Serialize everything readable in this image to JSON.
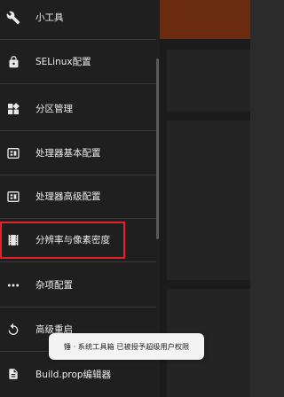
{
  "drawer": {
    "items": [
      {
        "label": "小工具",
        "icon": "wrench-icon"
      },
      {
        "label": "SELinux配置",
        "icon": "lock-icon"
      },
      {
        "label": "分区管理",
        "icon": "widgets-icon"
      },
      {
        "label": "处理器基本配置",
        "icon": "cpu-icon"
      },
      {
        "label": "处理器高级配置",
        "icon": "cpu-icon"
      },
      {
        "label": "分辨率与像素密度",
        "icon": "film-icon"
      },
      {
        "label": "杂项配置",
        "icon": "more-dots-icon"
      },
      {
        "label": "高级重启",
        "icon": "restart-icon"
      },
      {
        "label": "Build.prop编辑器",
        "icon": "file-icon"
      }
    ],
    "highlighted_item": "分辨率与像素密度"
  },
  "toast": {
    "text": "锤 · 系统工具箱 已被授予超级用户权限"
  },
  "colors": {
    "drawer_bg": "#1f1f1f",
    "accent_topbar": "#a4421b",
    "highlight_border": "#e0242a",
    "toast_bg": "#f4f4f4"
  }
}
